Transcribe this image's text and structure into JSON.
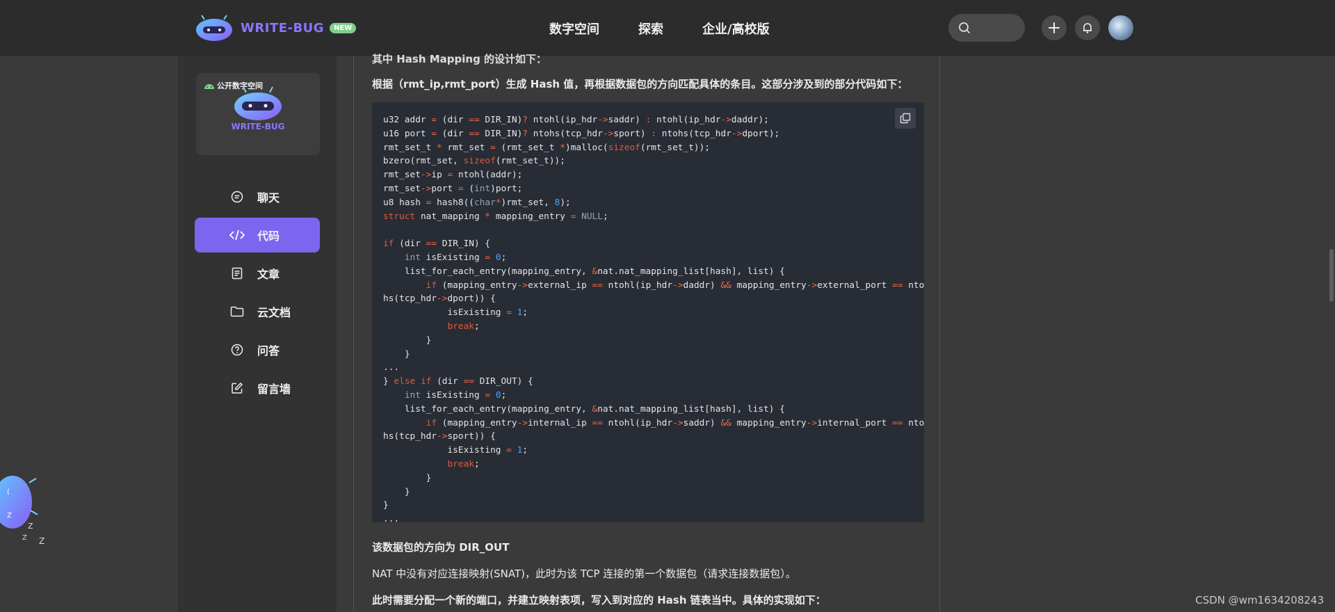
{
  "header": {
    "logo_text": "WRITE-BUG",
    "badge": "NEW",
    "nav": [
      "数字空间",
      "探索",
      "企业/高校版"
    ]
  },
  "sidebar": {
    "space_label": "公开数字空间",
    "space_logo_text": "WRITE-BUG",
    "menu": [
      {
        "label": "聊天",
        "icon": "chat-icon"
      },
      {
        "label": "代码",
        "icon": "code-icon",
        "active": true
      },
      {
        "label": "文章",
        "icon": "article-icon"
      },
      {
        "label": "云文档",
        "icon": "folder-icon"
      },
      {
        "label": "问答",
        "icon": "question-icon"
      },
      {
        "label": "留言墙",
        "icon": "edit-icon"
      }
    ]
  },
  "content": {
    "cut_text": "其中 Hash Mapping 的设计如下：",
    "para1": "根据（rmt_ip,rmt_port）生成 Hash 值，再根据数据包的方向匹配具体的条目。这部分涉及到的部分代码如下：",
    "para2": "该数据包的方向为 DIR_OUT",
    "para3": "NAT 中没有对应连接映射(SNAT)，此时为该 TCP 连接的第一个数据包（请求连接数据包）。",
    "para4": "此时需要分配一个新的端口，并建立映射表项，写入到对应的 Hash 链表当中。具体的实现如下："
  },
  "watermark": "CSDN @wm1634208243"
}
